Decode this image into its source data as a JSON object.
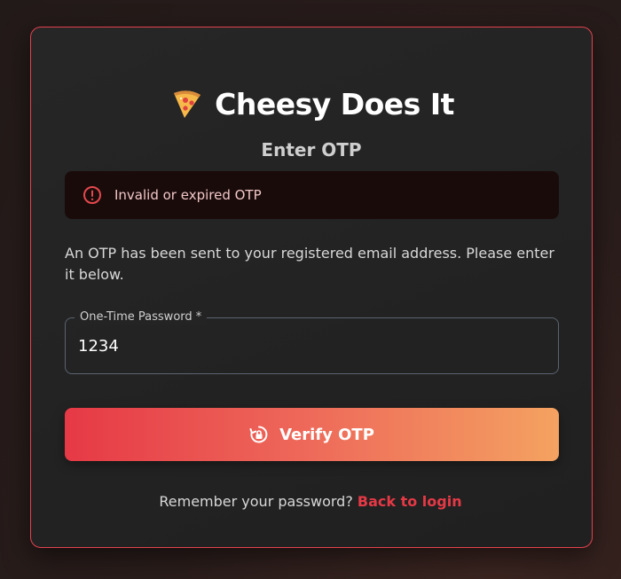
{
  "brand": {
    "icon": "pizza-icon",
    "title": "Cheesy Does It"
  },
  "page": {
    "subtitle": "Enter OTP"
  },
  "alert": {
    "icon": "error-circle-icon",
    "message": "Invalid or expired OTP"
  },
  "info": {
    "text": "An OTP has been sent to your registered email address. Please enter it below."
  },
  "otp_field": {
    "label": "One-Time Password *",
    "value": "1234"
  },
  "verify_button": {
    "icon": "lock-reset-icon",
    "label": "Verify OTP"
  },
  "footer": {
    "prompt": "Remember your password?",
    "link_label": "Back to login"
  },
  "colors": {
    "accent": "#e63946",
    "gradient_end": "#f4a261",
    "card_bg": "#242424",
    "alert_bg": "#1a0b0b"
  }
}
